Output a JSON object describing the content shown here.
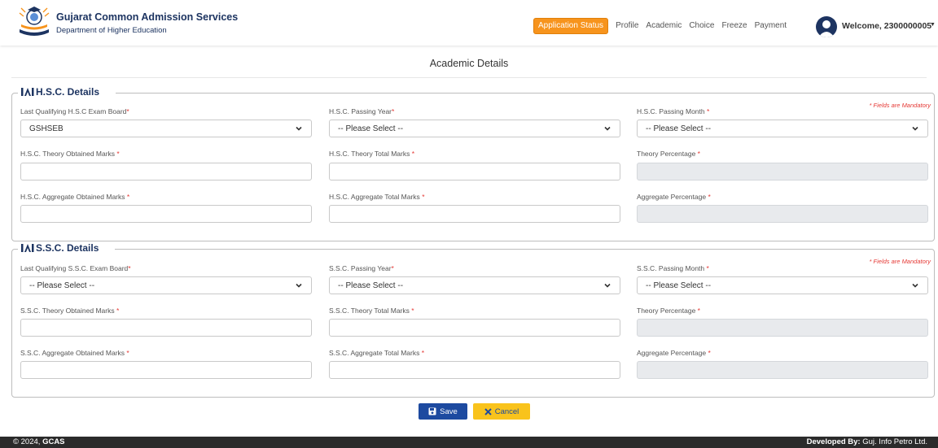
{
  "header": {
    "brand_title": "Gujarat Common Admission Services",
    "brand_subtitle": "Department of Higher Education",
    "logo_icon": "gcas-logo",
    "nav": {
      "application_status": "Application Status",
      "profile": "Profile",
      "academic": "Academic",
      "choice": "Choice",
      "freeze": "Freeze",
      "payment": "Payment"
    },
    "welcome": "Welcome, 2300000005",
    "avatar_icon": "user-avatar-icon",
    "accent_color": "#f7941d",
    "brand_color": "#1d3461"
  },
  "page_title": "Academic Details",
  "hsc": {
    "legend": "H.S.C. Details",
    "mandatory_note": "* Fields are Mandatory",
    "board_label": "Last Qualifying H.S.C Exam Board",
    "board_value": "GSHSEB",
    "year_label": "H.S.C. Passing Year",
    "year_value": "-- Please Select --",
    "month_label": "H.S.C. Passing Month ",
    "month_value": "-- Please Select --",
    "theory_obtained_label": "H.S.C. Theory Obtained Marks ",
    "theory_obtained_value": "",
    "theory_total_label": "H.S.C. Theory Total Marks ",
    "theory_total_value": "",
    "theory_pct_label": "Theory Percentage ",
    "theory_pct_value": "",
    "agg_obtained_label": "H.S.C. Aggregate Obtained Marks ",
    "agg_obtained_value": "",
    "agg_total_label": "H.S.C. Aggregate Total Marks ",
    "agg_total_value": "",
    "agg_pct_label": "Aggregate Percentage ",
    "agg_pct_value": ""
  },
  "ssc": {
    "legend": "S.S.C. Details",
    "mandatory_note": "* Fields are Mandatory",
    "board_label": "Last Qualifying S.S.C. Exam Board",
    "board_value": "-- Please Select --",
    "year_label": "S.S.C. Passing Year",
    "year_value": "-- Please Select --",
    "month_label": "S.S.C. Passing Month ",
    "month_value": "-- Please Select --",
    "theory_obtained_label": "S.S.C. Theory Obtained Marks ",
    "theory_obtained_value": "",
    "theory_total_label": "S.S.C. Theory Total Marks ",
    "theory_total_value": "",
    "theory_pct_label": "Theory Percentage ",
    "theory_pct_value": "",
    "agg_obtained_label": "S.S.C. Aggregate Obtained Marks ",
    "agg_obtained_value": "",
    "agg_total_label": "S.S.C. Aggregate Total Marks ",
    "agg_total_value": "",
    "agg_pct_label": "Aggregate Percentage ",
    "agg_pct_value": ""
  },
  "required_mark": "*",
  "buttons": {
    "save": "Save",
    "cancel": "Cancel",
    "save_icon": "floppy-disk-icon",
    "cancel_icon": "x-icon",
    "save_color": "#1d4aa0",
    "cancel_color": "#f9c31c"
  },
  "footer": {
    "copyright_prefix": "© 2024, ",
    "copyright_brand": "GCAS",
    "developed_by_label": "Developed By:",
    "developed_by_value": " Guj. Info Petro Ltd."
  }
}
